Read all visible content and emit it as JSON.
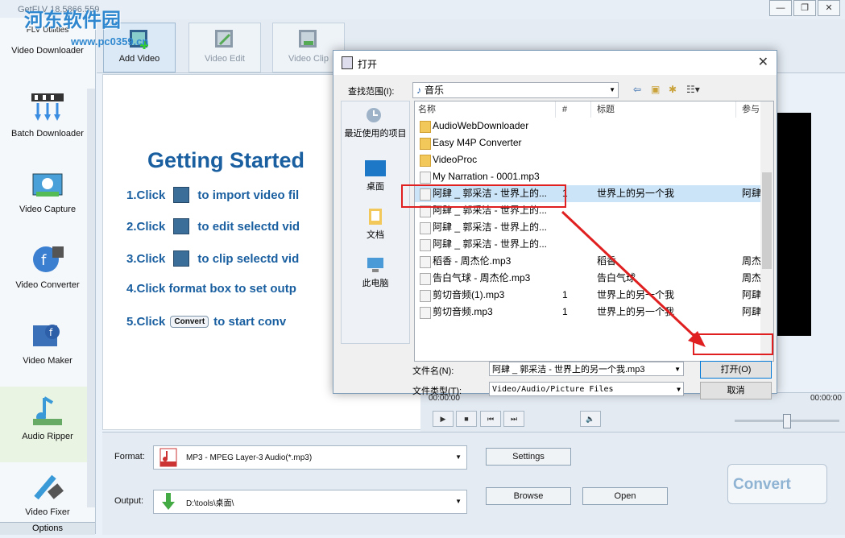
{
  "app": {
    "title": "GetFLV 18.5866.559",
    "watermark": "河东软件园",
    "watermark_url": "www.pc0359.cn"
  },
  "window_controls": {
    "minimize": "—",
    "restore": "❐",
    "close": "✕"
  },
  "sidebar": {
    "items": [
      {
        "label": "Video Downloader",
        "icon": "download-icon"
      },
      {
        "label": "Batch Downloader",
        "icon": "batch-download-icon"
      },
      {
        "label": "Video Capture",
        "icon": "capture-icon"
      },
      {
        "label": "Video Converter",
        "icon": "converter-icon"
      },
      {
        "label": "Video Maker",
        "icon": "maker-icon"
      },
      {
        "label": "Audio Ripper",
        "icon": "audio-ripper-icon"
      },
      {
        "label": "Video Fixer",
        "icon": "fixer-icon"
      }
    ],
    "top_fragment": "FLV Utilities",
    "options": "Options"
  },
  "toolbar": {
    "add_video": "Add Video",
    "video_edit": "Video Edit",
    "video_clip": "Video Clip"
  },
  "getting_started": {
    "title": "Getting Started",
    "steps": [
      {
        "pre": "1.Click",
        "post": "to import video fil"
      },
      {
        "pre": "2.Click",
        "post": "to edit selectd vid"
      },
      {
        "pre": "3.Click",
        "post": "to clip selectd vid"
      },
      {
        "pre": "4.Click format box to set outp",
        "post": ""
      },
      {
        "pre": "5.Click",
        "post": "to start conv"
      }
    ],
    "convert_mini": "Convert"
  },
  "player": {
    "time_left": "00:00:00",
    "time_right": "00:00:00",
    "buttons": [
      "▶",
      "■",
      "⏮",
      "⏭",
      "🔈"
    ]
  },
  "bottom": {
    "format_label": "Format:",
    "format_value": "MP3 - MPEG Layer-3 Audio(*.mp3)",
    "output_label": "Output:",
    "output_value": "D:\\tools\\桌面\\",
    "settings": "Settings",
    "browse": "Browse",
    "open": "Open",
    "convert": "Convert"
  },
  "dialog": {
    "title": "打开",
    "look_in_label": "查找范围(I):",
    "look_in_value": "音乐",
    "places": [
      "最近使用的项目",
      "桌面",
      "文档",
      "此电脑"
    ],
    "columns": {
      "name": "名称",
      "num": "#",
      "title": "标题",
      "artist": "参与"
    },
    "files": [
      {
        "name": "AudioWebDownloader",
        "num": "",
        "title": "",
        "artist": "",
        "type": "folder"
      },
      {
        "name": "Easy M4P Converter",
        "num": "",
        "title": "",
        "artist": "",
        "type": "folder"
      },
      {
        "name": "VideoProc",
        "num": "",
        "title": "",
        "artist": "",
        "type": "folder"
      },
      {
        "name": "My Narration - 0001.mp3",
        "num": "",
        "title": "",
        "artist": "",
        "type": "file"
      },
      {
        "name": "阿肆 _ 郭采洁 - 世界上的...",
        "num": "1",
        "title": "世界上的另一个我",
        "artist": "阿肆",
        "type": "file"
      },
      {
        "name": "阿肆 _ 郭采洁 - 世界上的...",
        "num": "",
        "title": "",
        "artist": "",
        "type": "file"
      },
      {
        "name": "阿肆 _ 郭采洁 - 世界上的...",
        "num": "",
        "title": "",
        "artist": "",
        "type": "file"
      },
      {
        "name": "阿肆 _ 郭采洁 - 世界上的...",
        "num": "",
        "title": "",
        "artist": "",
        "type": "file"
      },
      {
        "name": "稻香 - 周杰伦.mp3",
        "num": "",
        "title": "稻香",
        "artist": "周杰",
        "type": "file"
      },
      {
        "name": "告白气球 - 周杰伦.mp3",
        "num": "",
        "title": "告白气球",
        "artist": "周杰",
        "type": "file"
      },
      {
        "name": "剪切音频(1).mp3",
        "num": "1",
        "title": "世界上的另一个我",
        "artist": "阿肆",
        "type": "file"
      },
      {
        "name": "剪切音频.mp3",
        "num": "1",
        "title": "世界上的另一个我",
        "artist": "阿肆",
        "type": "file"
      }
    ],
    "filename_label": "文件名(N):",
    "filename_value": "阿肆 _ 郭采洁 - 世界上的另一个我.mp3",
    "filetype_label": "文件类型(T):",
    "filetype_value": "Video/Audio/Picture Files",
    "open_button": "打开(O)",
    "cancel_button": "取消"
  },
  "colors": {
    "accent_blue": "#1a5fa0",
    "highlight_red": "#e02020",
    "selection": "#cce4f7"
  }
}
